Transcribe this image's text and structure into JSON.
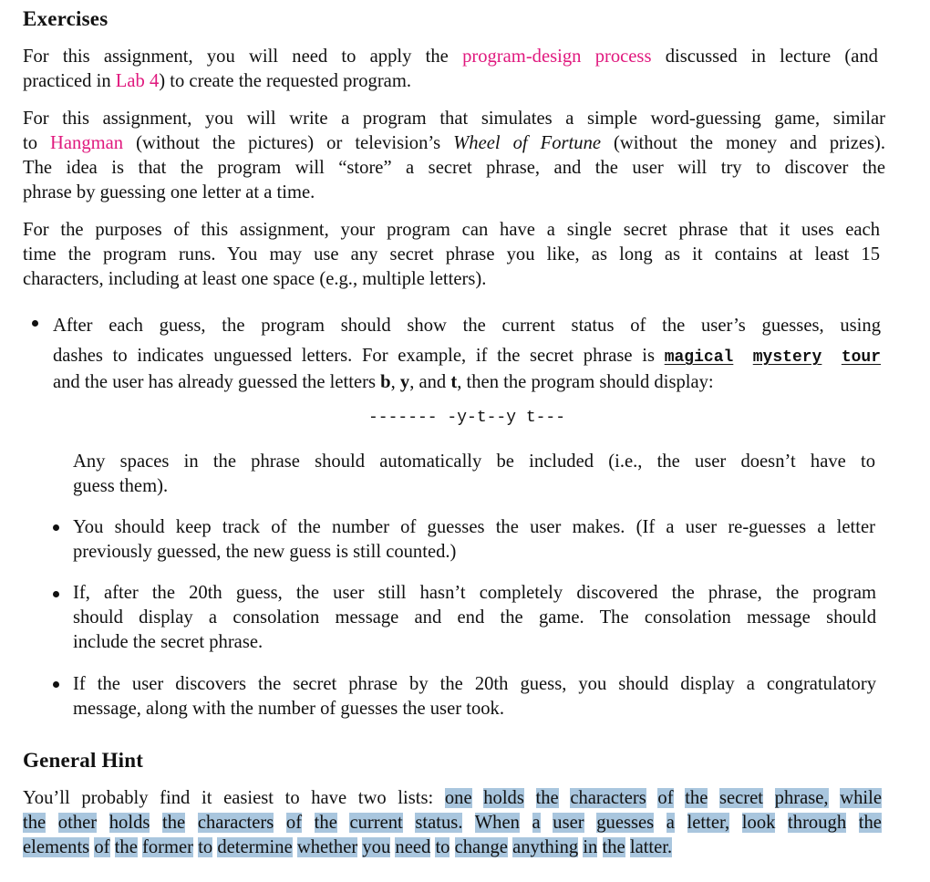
{
  "sections": {
    "exercises": {
      "heading": "Exercises",
      "para1": {
        "before_link1": "For this assignment, you will need to apply the ",
        "link1": "program-design process",
        "between": " discussed in lecture (and",
        "line2_before": "practiced in ",
        "link2": "Lab 4",
        "after": ") to create the requested program."
      },
      "para2": {
        "line1": "For this assignment, you will write a program that simulates a simple word-guessing game, similar",
        "line2_before": "to ",
        "link": "Hangman",
        "line2_mid": " (without the pictures) or television’s ",
        "italic": "Wheel of Fortune",
        "line2_after": " (without the money and prizes).",
        "line3": "The idea is that the program will “store” a secret phrase, and the user will try to discover the",
        "line4": "phrase by guessing one letter at a time."
      },
      "para3": {
        "line1": "For the purposes of this assignment, your program can have a single secret phrase that it uses each",
        "line2": "time the program runs. You may use any secret phrase you like, as long as it contains at least 15",
        "line3": "characters, including at least one space (e.g., multiple letters)."
      },
      "bullets": [
        {
          "line1": "After each guess, the program should show the current status of the user’s guesses, using",
          "line2_before": "dashes to indicates unguessed letters. For example, if the secret phrase is ",
          "code_words": [
            "magical",
            "mystery",
            "tour"
          ],
          "line3_before": "and the user has already guessed the letters ",
          "letters": [
            "b",
            "y",
            "t"
          ],
          "sep1": ", ",
          "sep2": ", and ",
          "line3_after": ", then the program should display:",
          "status_display": "------- -y-t--y t---",
          "follow_line1": "Any spaces in the phrase should automatically be included (i.e., the user doesn’t have to",
          "follow_line2": "guess them)."
        },
        {
          "line1": "You should keep track of the number of guesses the user makes. (If a user re-guesses a letter",
          "line2": "previously guessed, the new guess is still counted.)"
        },
        {
          "line1": "If, after the 20th guess, the user still hasn’t completely discovered the phrase, the program",
          "line2": "should display a consolation message and end the game.  The consolation message should",
          "line3": "include the secret phrase."
        },
        {
          "line1": "If the user discovers the secret phrase by the 20th guess, you should display a congratulatory",
          "line2": "message, along with the number of guesses the user took."
        }
      ]
    },
    "hint": {
      "heading": "General Hint",
      "line1_plain": "You’ll probably find it easiest to have two lists: ",
      "line1_highlighted": [
        "one",
        "holds",
        "the",
        "characters",
        "of",
        "the",
        "secret",
        "phrase,",
        "while"
      ],
      "line2_highlighted": [
        "the",
        "other",
        "holds",
        "the",
        "characters",
        "of",
        "the",
        "current",
        "status.",
        "When",
        "a",
        "user",
        "guesses",
        "a",
        "letter,",
        "look",
        "through",
        "the"
      ],
      "line3_highlighted": [
        "elements",
        "of",
        "the",
        "former",
        "to",
        "determine",
        "whether",
        "you",
        "need",
        "to",
        "change",
        "anything",
        "in",
        "the",
        "latter."
      ]
    }
  },
  "colors": {
    "link": "#e0197e",
    "highlight": "#a9c6de",
    "text": "#111111"
  }
}
